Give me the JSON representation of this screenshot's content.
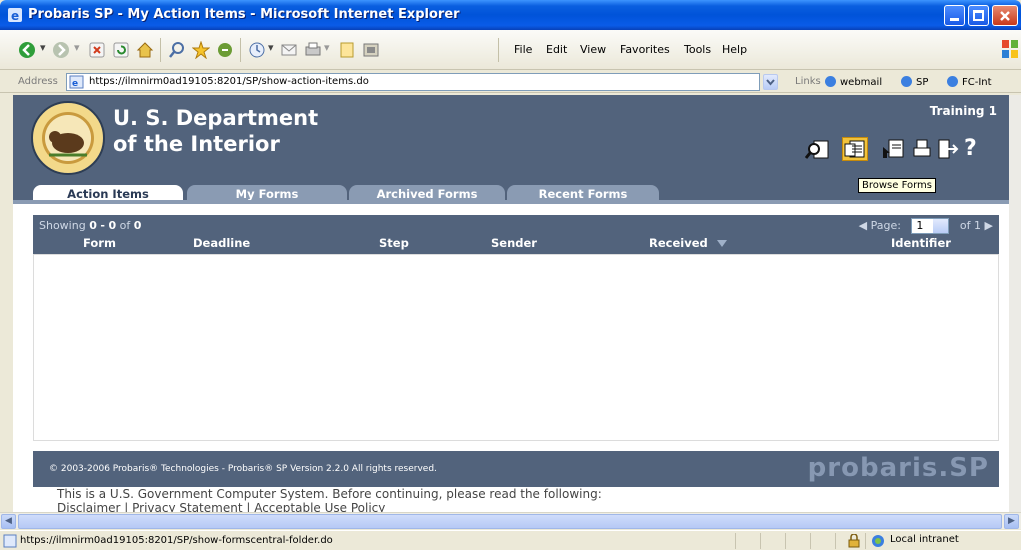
{
  "window": {
    "title": "Probaris SP - My Action Items - Microsoft Internet Explorer"
  },
  "menu": {
    "items": [
      "File",
      "Edit",
      "View",
      "Favorites",
      "Tools",
      "Help"
    ]
  },
  "address": {
    "label": "Address",
    "url": "https://ilmnirm0ad19105:8201/SP/show-action-items.do"
  },
  "links": {
    "label": "Links",
    "items": [
      "webmail",
      "SP",
      "FC-Int"
    ]
  },
  "header": {
    "department_line1": "U. S. Department",
    "department_line2": "of the Interior",
    "user": "Training 1",
    "icons": [
      "search-forms-icon",
      "browse-forms-icon",
      "inbox-forms-icon",
      "print-icon",
      "logout-icon",
      "help-icon"
    ],
    "tooltip": "Browse Forms",
    "help_glyph": "?"
  },
  "tabs": [
    {
      "label": "Action Items",
      "active": true
    },
    {
      "label": "My Forms",
      "active": false
    },
    {
      "label": "Archived Forms",
      "active": false
    },
    {
      "label": "Recent Forms",
      "active": false
    }
  ],
  "grid": {
    "showing_prefix": "Showing",
    "range_start": "0",
    "range_sep": "-",
    "range_end": "0",
    "of_label": "of",
    "total": "0",
    "page_label": "Page:",
    "page_value": "1",
    "page_of": "of 1",
    "columns": [
      "Form",
      "Deadline",
      "Step",
      "Sender",
      "Received",
      "Identifier"
    ]
  },
  "footer": {
    "copyright": "© 2003-2006 Probaris® Technologies - Probaris® SP Version 2.2.0 All rights reserved.",
    "brand": "probaris.SP",
    "notice_line1": "This is a U.S. Government Computer System. Before continuing, please read the following:",
    "notice_line2": "Disclaimer | Privacy Statement | Acceptable Use Policy"
  },
  "status": {
    "url": "https://ilmnirm0ad19105:8201/SP/show-formscentral-folder.do",
    "zone": "Local intranet"
  },
  "colors": {
    "header_band": "#52637c",
    "tab_inactive": "#8a9bb3",
    "xp_titlebar": "#0053d9"
  }
}
